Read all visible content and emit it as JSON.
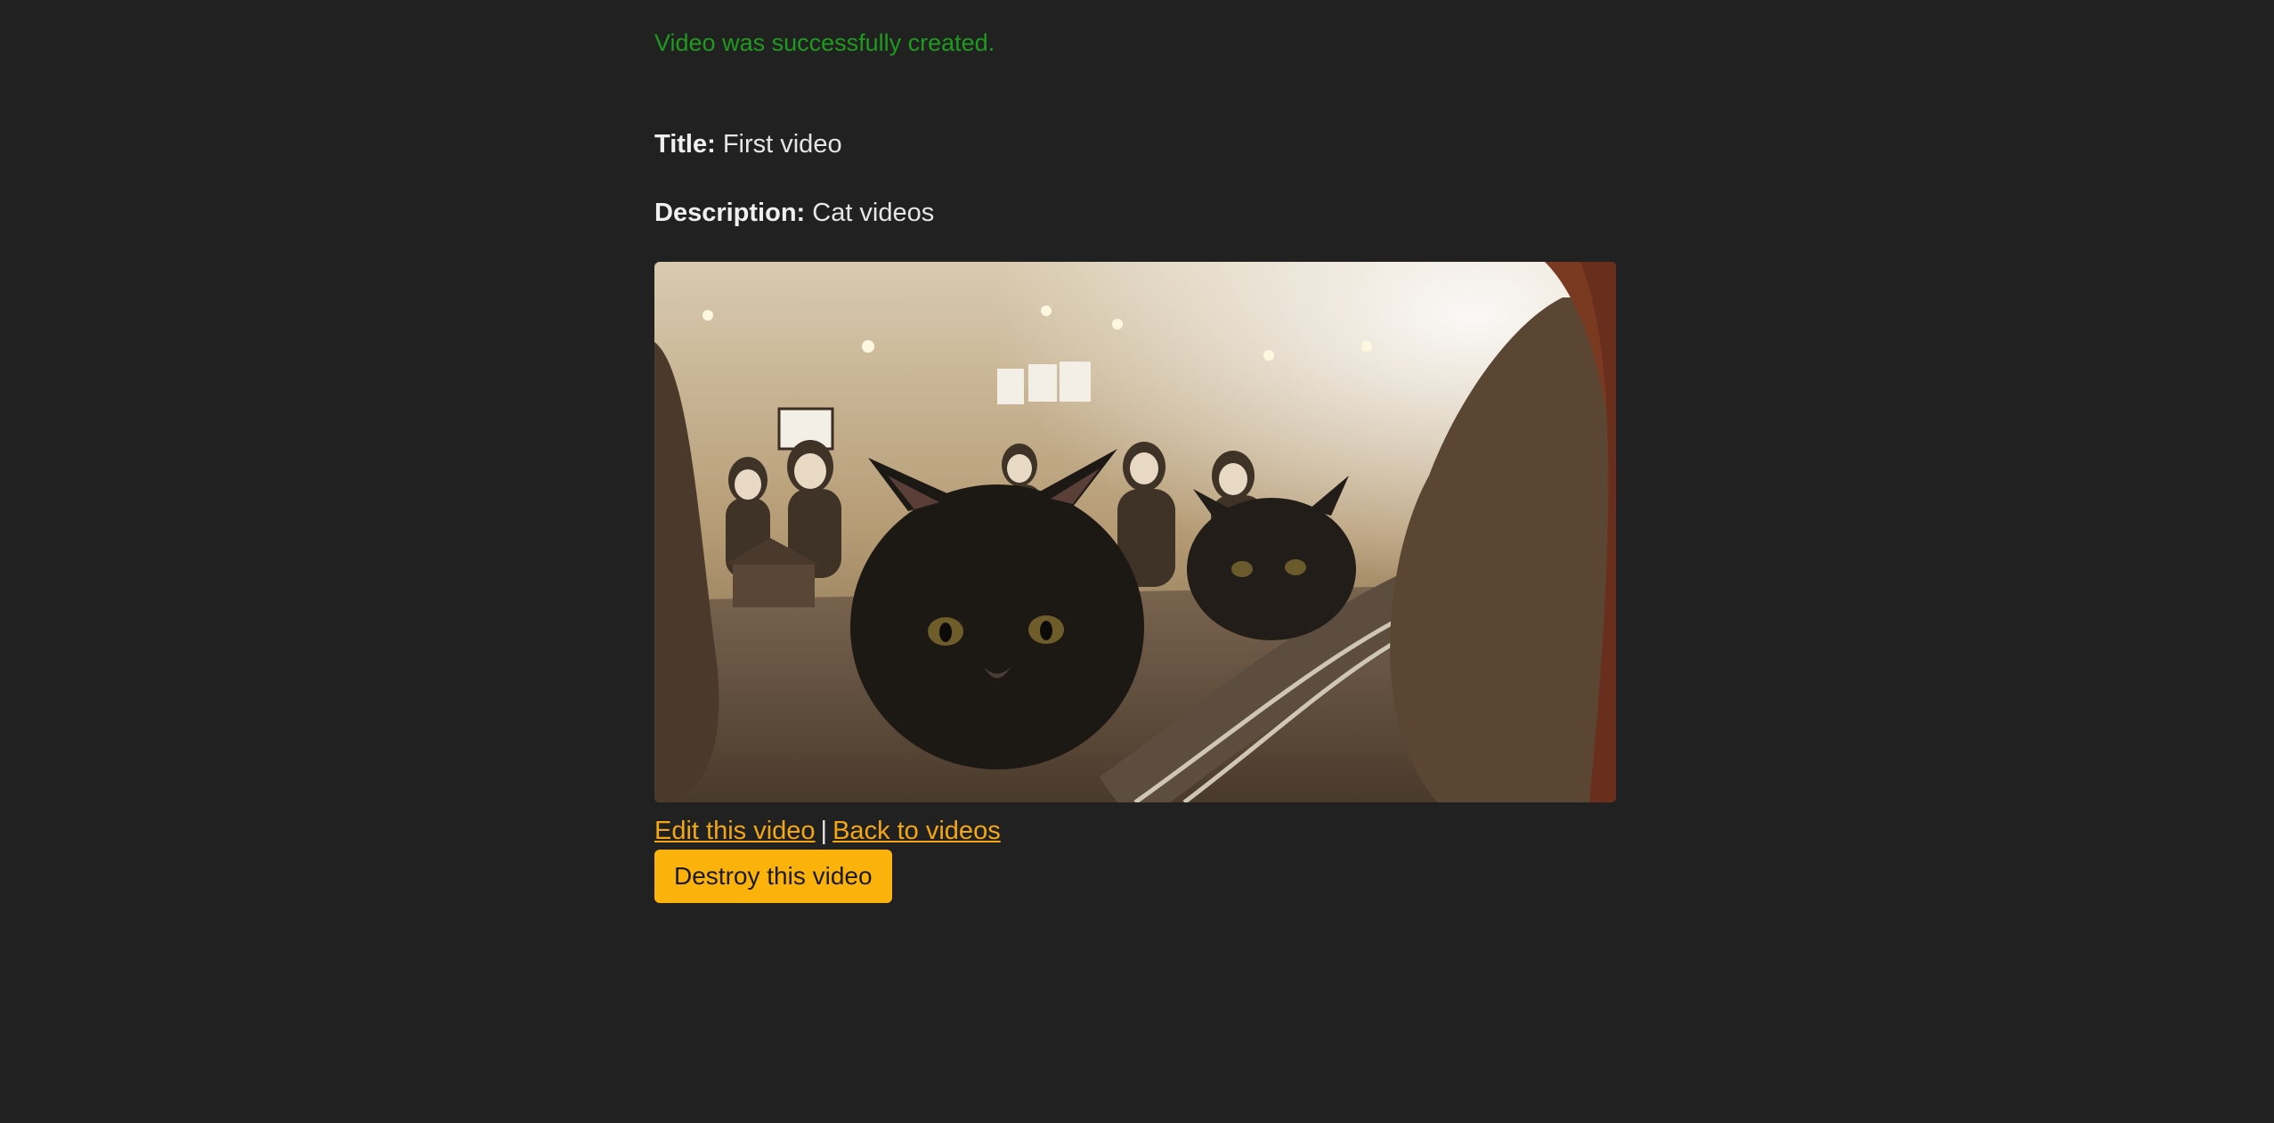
{
  "notice": "Video was successfully created.",
  "fields": {
    "title_label": "Title:",
    "title_value": "First video",
    "description_label": "Description:",
    "description_value": "Cat videos"
  },
  "video": {
    "subject": "two black cats peeking over a model railway track"
  },
  "actions": {
    "edit_label": "Edit this video",
    "separator": "|",
    "back_label": "Back to videos",
    "destroy_label": "Destroy this video"
  },
  "colors": {
    "background": "#212121",
    "notice": "#1e9b1e",
    "link": "#f3a712",
    "button": "#fbb20b"
  }
}
